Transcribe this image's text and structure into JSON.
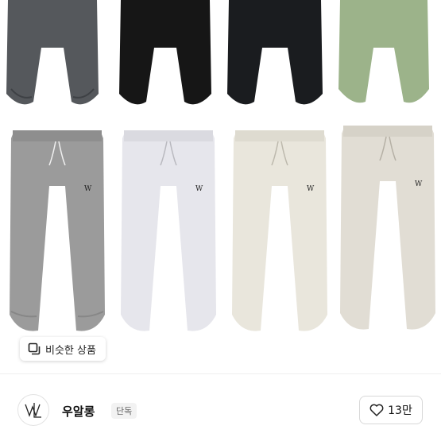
{
  "similar_products": {
    "label": "비슷한 상품",
    "icon": "similar-items-icon"
  },
  "seller": {
    "name": "우알롱",
    "badge": "단독",
    "logo": "wooalong-logo"
  },
  "like": {
    "count": "13만",
    "icon": "heart-outline-icon"
  },
  "colors": {
    "row1": [
      "#55585c",
      "#161616",
      "#1a1c1f",
      "#9cb38a"
    ],
    "row2": [
      "#9b9b9b",
      "#e6e6ec",
      "#e9e6dc",
      "#e1ddd4"
    ]
  }
}
